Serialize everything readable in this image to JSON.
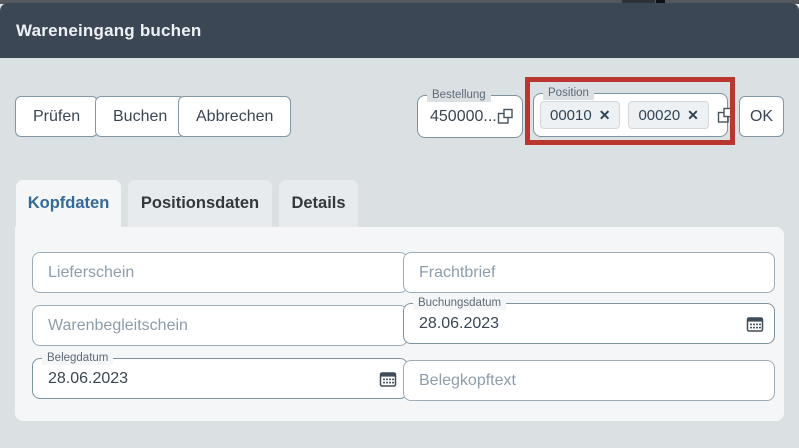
{
  "window": {
    "title": "Wareneingang buchen"
  },
  "toolbar": {
    "pruefen_label": "Prüfen",
    "buchen_label": "Buchen",
    "abbrechen_label": "Abbrechen",
    "ok_label": "OK"
  },
  "order_field": {
    "label": "Bestellung",
    "value": "450000..."
  },
  "position_field": {
    "label": "Position",
    "tokens": [
      "00010",
      "00020"
    ]
  },
  "icons": {
    "token_remove": "✕",
    "value_help": "value-help-icon (two overlapping squares)",
    "calendar": "calendar-icon"
  },
  "tabs": [
    {
      "label": "Kopfdaten",
      "active": true
    },
    {
      "label": "Positionsdaten",
      "active": false
    },
    {
      "label": "Details",
      "active": false
    }
  ],
  "fields": {
    "lieferschein": {
      "placeholder": "Lieferschein",
      "value": ""
    },
    "frachtbrief": {
      "placeholder": "Frachtbrief",
      "value": ""
    },
    "warenbegleitschein": {
      "placeholder": "Warenbegleitschein",
      "value": ""
    },
    "buchungsdatum": {
      "label": "Buchungsdatum",
      "value": "28.06.2023"
    },
    "belegdatum": {
      "label": "Belegdatum",
      "value": "28.06.2023"
    },
    "belegkopftext": {
      "placeholder": "Belegkopftext",
      "value": ""
    }
  },
  "colors": {
    "titlebar": "#3b4754",
    "dialog_background": "#dbe0e3",
    "panel_background": "#f4f6f8",
    "annotation_red": "#b9372e",
    "active_tab_text": "#336a99"
  }
}
